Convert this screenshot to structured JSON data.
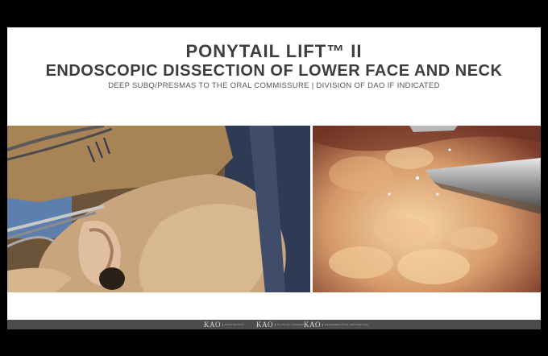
{
  "slide": {
    "title": "PONYTAIL LIFT™ II",
    "subtitle": "ENDOSCOPIC DISSECTION OF LOWER FACE AND NECK",
    "caption": "DEEP SUBQ/PRESMAS TO THE ORAL COMMISSURE | DIVISION OF DAO IF INDICATED"
  },
  "footer": {
    "brands": [
      {
        "name": "KAO",
        "tag": "AESTHETICS"
      },
      {
        "name": "KAO",
        "tag": "PLASTIC SURGERY"
      },
      {
        "name": "KAO",
        "tag": "REGENERATIVE AESTHETICS"
      }
    ]
  },
  "colors": {
    "title_text": "#3e3e3e",
    "footer_bar": "#4d4d4d",
    "letterbox": "#000000"
  }
}
